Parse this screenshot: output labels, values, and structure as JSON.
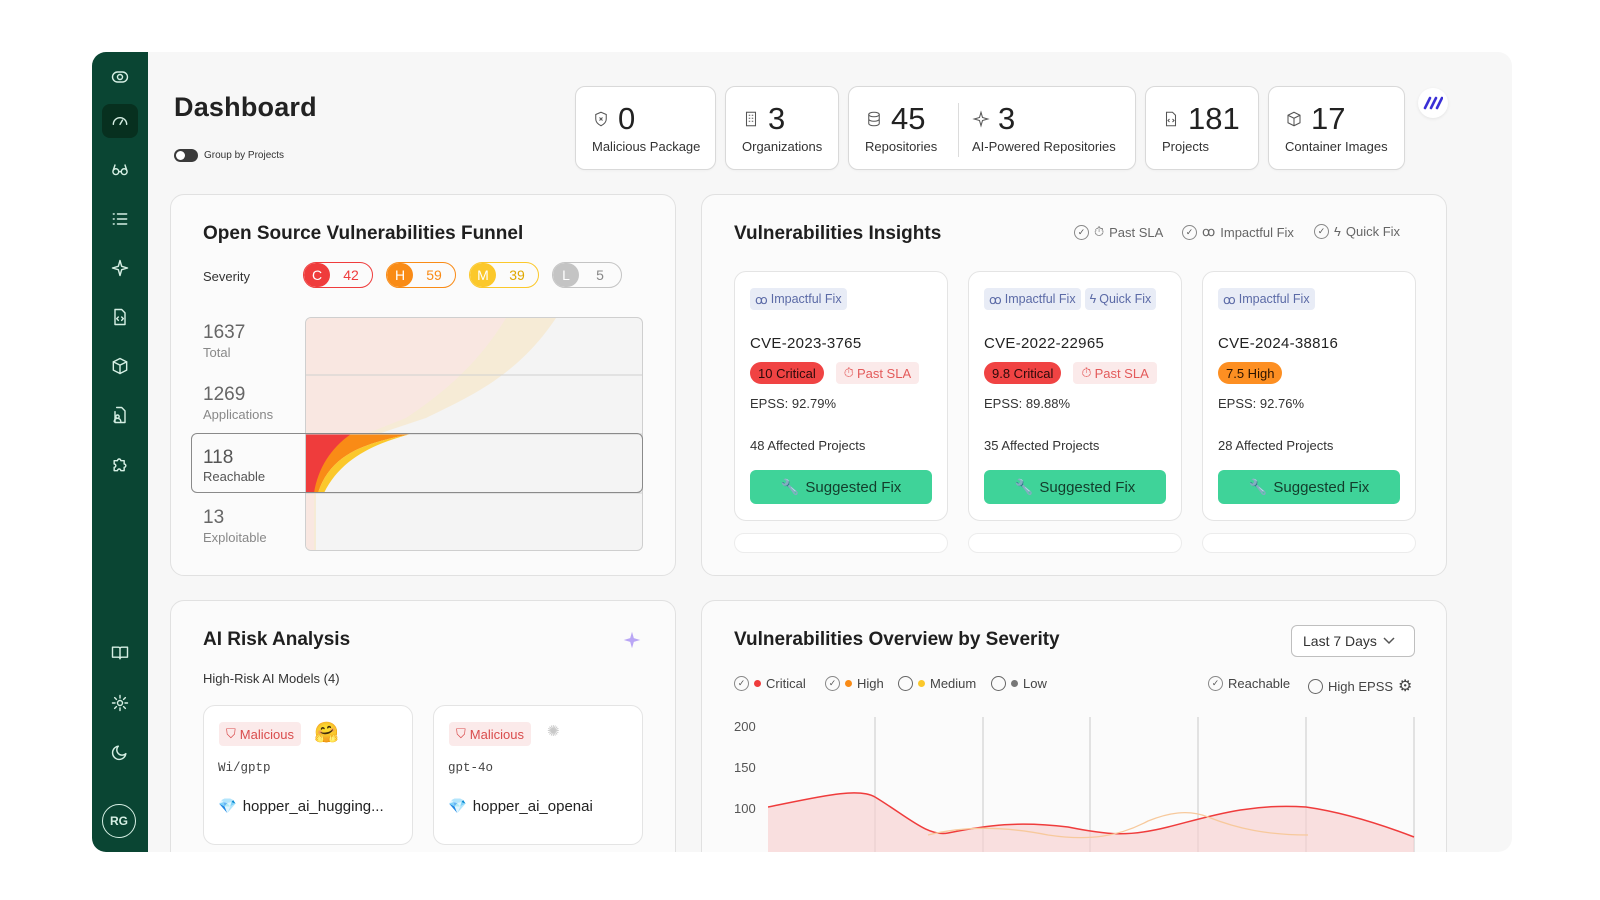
{
  "page": {
    "title": "Dashboard",
    "group_toggle_label": "Group by Projects",
    "avatar_initials": "RG"
  },
  "sidebar": {
    "items": [
      "logo-icon",
      "dashboard-icon",
      "glasses-icon",
      "list-icon",
      "sparkle-icon",
      "code-file-icon",
      "package-icon",
      "file-user-icon",
      "puzzle-icon",
      "book-icon",
      "settings-icon",
      "moon-icon"
    ],
    "active": "dashboard-icon"
  },
  "stats": {
    "malicious": {
      "value": "0",
      "label": "Malicious Package"
    },
    "orgs": {
      "value": "3",
      "label": "Organizations"
    },
    "repos": {
      "value": "45",
      "label": "Repositories"
    },
    "ai_repos": {
      "value": "3",
      "label": "AI-Powered Repositories"
    },
    "projects": {
      "value": "181",
      "label": "Projects"
    },
    "containers": {
      "value": "17",
      "label": "Container Images"
    }
  },
  "funnel": {
    "title": "Open Source Vulnerabilities Funnel",
    "severity_label": "Severity",
    "severities": [
      {
        "key": "C",
        "value": "42",
        "color": "#ef3c3c"
      },
      {
        "key": "H",
        "value": "59",
        "color": "#f98b16"
      },
      {
        "key": "M",
        "value": "39",
        "color": "#fbc82b"
      },
      {
        "key": "L",
        "value": "5",
        "color": "#c4c4c4"
      }
    ],
    "stages": [
      {
        "value": "1637",
        "label": "Total"
      },
      {
        "value": "1269",
        "label": "Applications"
      },
      {
        "value": "118",
        "label": "Reachable"
      },
      {
        "value": "13",
        "label": "Exploitable"
      }
    ]
  },
  "insights": {
    "title": "Vulnerabilities Insights",
    "filters": [
      "Past SLA",
      "Impactful Fix",
      "Quick Fix"
    ],
    "cards": [
      {
        "tags": [
          "Impactful Fix"
        ],
        "cve": "CVE-2023-3765",
        "score": "10 Critical",
        "sla": "Past SLA",
        "epss": "EPSS: 92.79%",
        "affected": "48 Affected Projects",
        "button": "Suggested Fix"
      },
      {
        "tags": [
          "Impactful Fix",
          "Quick Fix"
        ],
        "cve": "CVE-2022-22965",
        "score": "9.8 Critical",
        "sla": "Past SLA",
        "epss": "EPSS: 89.88%",
        "affected": "35 Affected Projects",
        "button": "Suggested Fix"
      },
      {
        "tags": [
          "Impactful Fix"
        ],
        "cve": "CVE-2024-38816",
        "score": "7.5 High",
        "sla": "",
        "epss": "EPSS: 92.76%",
        "affected": "28 Affected Projects",
        "button": "Suggested Fix"
      }
    ],
    "colors": {
      "critical_bg": "#f04343",
      "high_bg": "#fd8f22",
      "fix_bg": "#3fd399"
    }
  },
  "ai_risk": {
    "title": "AI Risk Analysis",
    "subtitle": "High-Risk AI Models (4)",
    "models": [
      {
        "badge": "Malicious",
        "id": "Wi/gptp",
        "name": "hopper_ai_hugging..."
      },
      {
        "badge": "Malicious",
        "id": "gpt-4o",
        "name": "hopper_ai_openai"
      }
    ]
  },
  "overview": {
    "title": "Vulnerabilities Overview by Severity",
    "range": "Last 7 Days",
    "legend": [
      {
        "label": "Critical",
        "checked": true,
        "color": "#ef3c3c"
      },
      {
        "label": "High",
        "checked": true,
        "color": "#f98b16"
      },
      {
        "label": "Medium",
        "checked": false,
        "color": "#fbc82b"
      },
      {
        "label": "Low",
        "checked": false,
        "color": "#777777"
      }
    ],
    "options": [
      {
        "label": "Reachable",
        "checked": true
      },
      {
        "label": "High EPSS",
        "checked": false
      }
    ],
    "yticks": [
      "200",
      "150",
      "100"
    ]
  }
}
